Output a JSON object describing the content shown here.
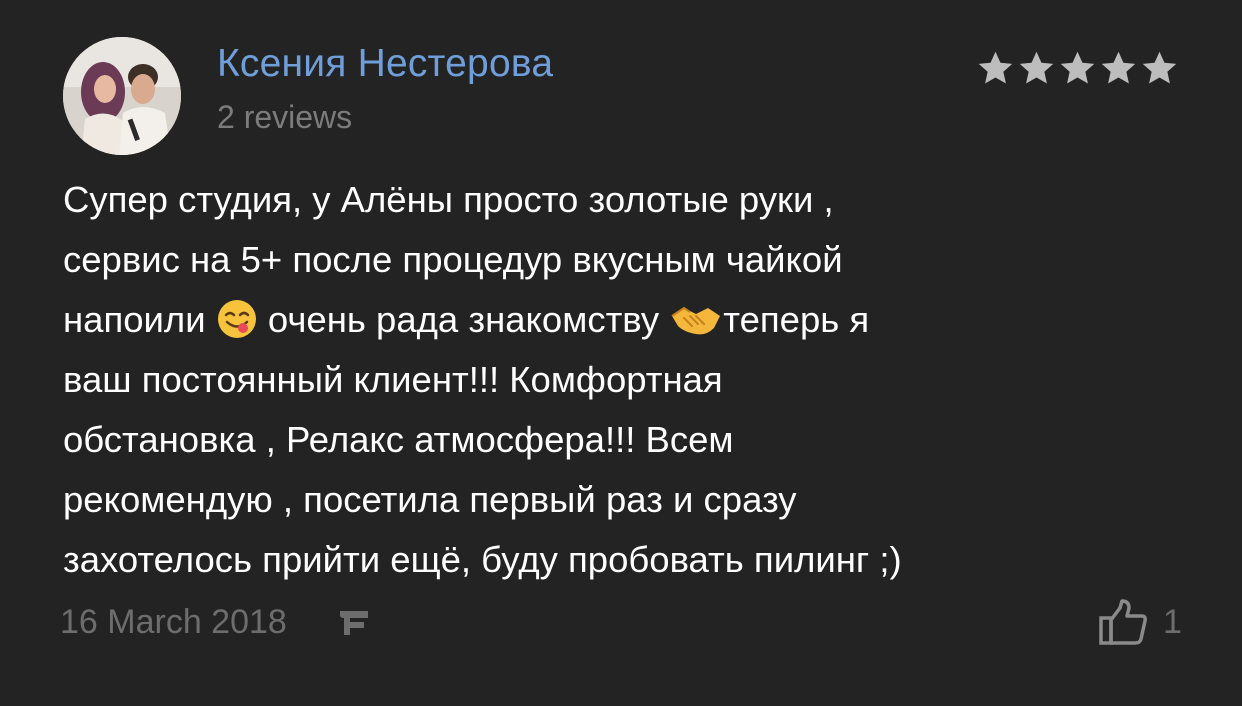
{
  "review": {
    "author_name": "Ксения Нестерова",
    "review_count": "2 reviews",
    "rating": 5,
    "rating_max": 5,
    "star_color": "#bdbdbd",
    "text_lines": {
      "l1": "Супер студия, у Алёны просто золотые руки ,",
      "l2": "сервис на 5+ после процедур вкусным чайкой",
      "l3a": "напоили ",
      "l3b": " очень рада знакомству ",
      "l3c": "теперь я",
      "l4": "ваш постоянный клиент!!! Комфортная",
      "l5": "обстановка , Релакс атмосфера!!! Всем",
      "l6": "рекомендую , посетила первый раз и сразу",
      "l7": "захотелось прийти ещё, буду пробовать пилинг ;)"
    },
    "emojis": [
      "yum-face-emoji",
      "handshake-emoji"
    ],
    "date": "16 March 2018",
    "source_icon": "foursquare-icon",
    "likes": "1",
    "like_icon": "thumbs-up-icon"
  },
  "colors": {
    "background": "#232323",
    "author_name": "#6f9ed9",
    "muted": "#7c7c7c"
  }
}
